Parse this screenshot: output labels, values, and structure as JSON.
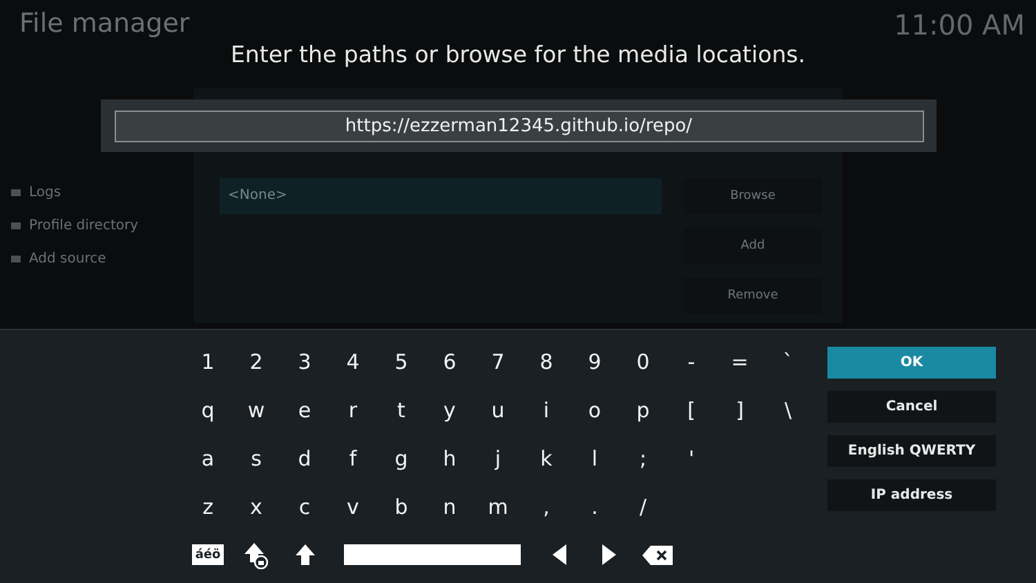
{
  "background": {
    "title": "File manager",
    "clock": "11:00 AM",
    "sidebar": [
      {
        "label": "Logs"
      },
      {
        "label": "Profile directory"
      },
      {
        "label": "Add source"
      }
    ],
    "source_dialog": {
      "path": "<None>",
      "buttons": [
        "Browse",
        "Add",
        "Remove"
      ]
    }
  },
  "dialog": {
    "heading": "Enter the paths or browse for the media locations.",
    "value": "https://ezzerman12345.github.io/repo/",
    "keys": [
      [
        "1",
        "2",
        "3",
        "4",
        "5",
        "6",
        "7",
        "8",
        "9",
        "0",
        "-",
        "=",
        "`"
      ],
      [
        "q",
        "w",
        "e",
        "r",
        "t",
        "y",
        "u",
        "i",
        "o",
        "p",
        "[",
        "]",
        "\\"
      ],
      [
        "a",
        "s",
        "d",
        "f",
        "g",
        "h",
        "j",
        "k",
        "l",
        ";",
        "'"
      ],
      [
        "z",
        "x",
        "c",
        "v",
        "b",
        "n",
        "m",
        ",",
        ".",
        "/"
      ]
    ],
    "bottom_row": [
      {
        "kind": "symbols",
        "label": "áéö"
      },
      {
        "kind": "capslock"
      },
      {
        "kind": "shift"
      },
      {
        "kind": "space"
      },
      {
        "kind": "left"
      },
      {
        "kind": "right"
      },
      {
        "kind": "backspace"
      }
    ],
    "buttons": [
      {
        "label": "OK",
        "selected": true
      },
      {
        "label": "Cancel",
        "selected": false
      },
      {
        "label": "English QWERTY",
        "selected": false
      },
      {
        "label": "IP address",
        "selected": false
      }
    ]
  }
}
